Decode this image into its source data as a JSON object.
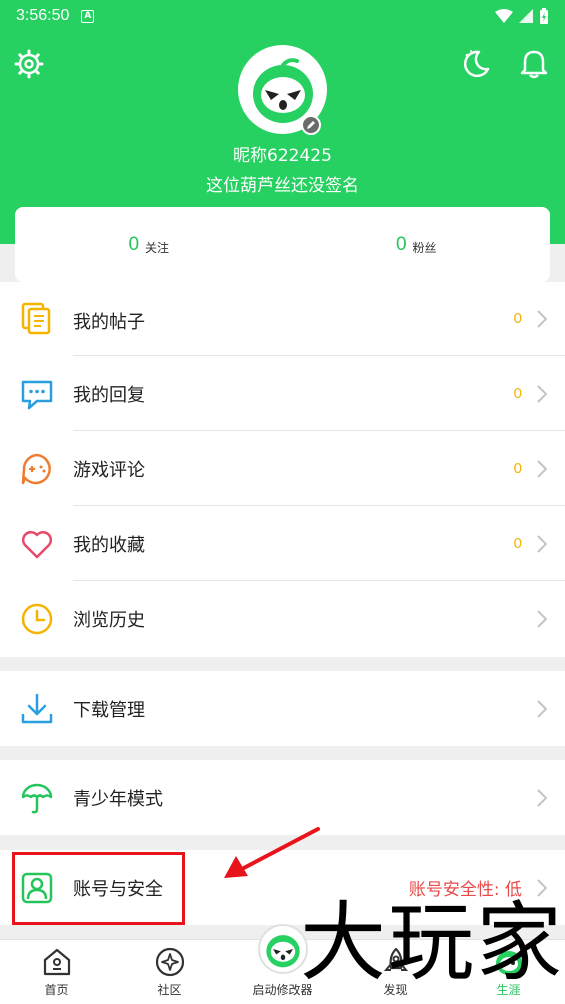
{
  "status_bar": {
    "time": "3:56:50"
  },
  "profile": {
    "nickname": "昵称622425",
    "signature": "这位葫芦丝还没签名"
  },
  "stats": [
    {
      "value": "0",
      "label": "关注"
    },
    {
      "value": "0",
      "label": "粉丝"
    }
  ],
  "menu_group_1": [
    {
      "label": "我的帖子",
      "count": "0",
      "icon": "document-icon"
    },
    {
      "label": "我的回复",
      "count": "0",
      "icon": "chat-bubble-icon"
    },
    {
      "label": "游戏评论",
      "count": "0",
      "icon": "gamepad-icon"
    },
    {
      "label": "我的收藏",
      "count": "0",
      "icon": "heart-icon"
    },
    {
      "label": "浏览历史",
      "count": "",
      "icon": "clock-icon"
    }
  ],
  "menu_group_2": [
    {
      "label": "下载管理",
      "icon": "download-icon"
    }
  ],
  "menu_group_3": [
    {
      "label": "青少年模式",
      "icon": "umbrella-icon"
    }
  ],
  "menu_group_4": [
    {
      "label": "账号与安全",
      "status": "账号安全性: 低",
      "icon": "user-card-icon"
    }
  ],
  "tabbar": [
    {
      "label": "首页",
      "icon": "home-icon"
    },
    {
      "label": "社区",
      "icon": "compass-icon"
    },
    {
      "label": "启动修改器",
      "icon": "mascot-icon"
    },
    {
      "label": "发现",
      "icon": "rocket-icon"
    },
    {
      "label": "生涯",
      "icon": "profile-icon"
    }
  ],
  "watermark": "大玩家",
  "colors": {
    "brand_green": "#26d061",
    "count_yellow": "#f5b400",
    "warning_red": "#e84a4a",
    "highlight_red": "#e8141c"
  }
}
